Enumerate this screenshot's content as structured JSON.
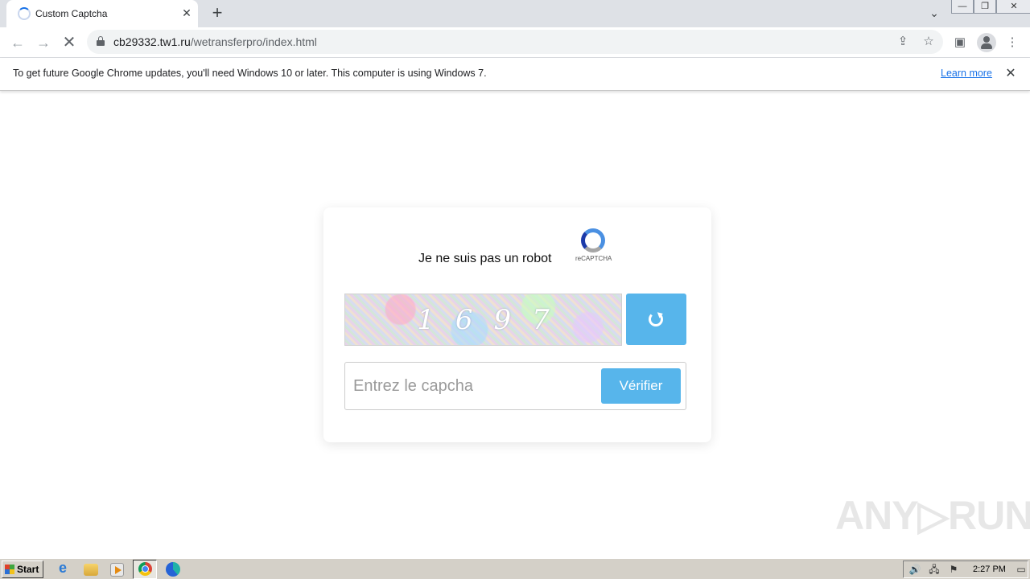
{
  "browser": {
    "tab": {
      "title": "Custom Captcha",
      "close_glyph": "✕"
    },
    "new_tab_glyph": "+",
    "tab_search_glyph": "⌄",
    "window_controls": {
      "minimize": "—",
      "restore": "❐",
      "close": "✕"
    },
    "nav": {
      "back": "←",
      "forward": "→",
      "reload": "✕"
    },
    "address": {
      "host": "cb29332.tw1.ru",
      "path": "/wetransferpro/index.html"
    },
    "omnibox_icons": {
      "share": "⇪",
      "bookmark": "☆"
    },
    "toolbar_icons": {
      "side_panel": "▣",
      "menu": "⋮"
    }
  },
  "infobar": {
    "message": "To get future Google Chrome updates, you'll need Windows 10 or later. This computer is using Windows 7.",
    "link": "Learn more",
    "close_glyph": "✕"
  },
  "captcha": {
    "heading": "Je ne suis pas un robot",
    "recaptcha_label": "reCAPTCHA",
    "digits": "1697",
    "input_placeholder": "Entrez le capcha",
    "input_value": "",
    "verify_label": "Vérifier",
    "accent_color": "#57b5eb"
  },
  "watermark": "ANY▷RUN",
  "taskbar": {
    "start_label": "Start",
    "clock": "2:27 PM",
    "tray_icons": {
      "volume": "🔊",
      "network": "🖧",
      "flag": "⚑",
      "desktop": "▭"
    }
  }
}
